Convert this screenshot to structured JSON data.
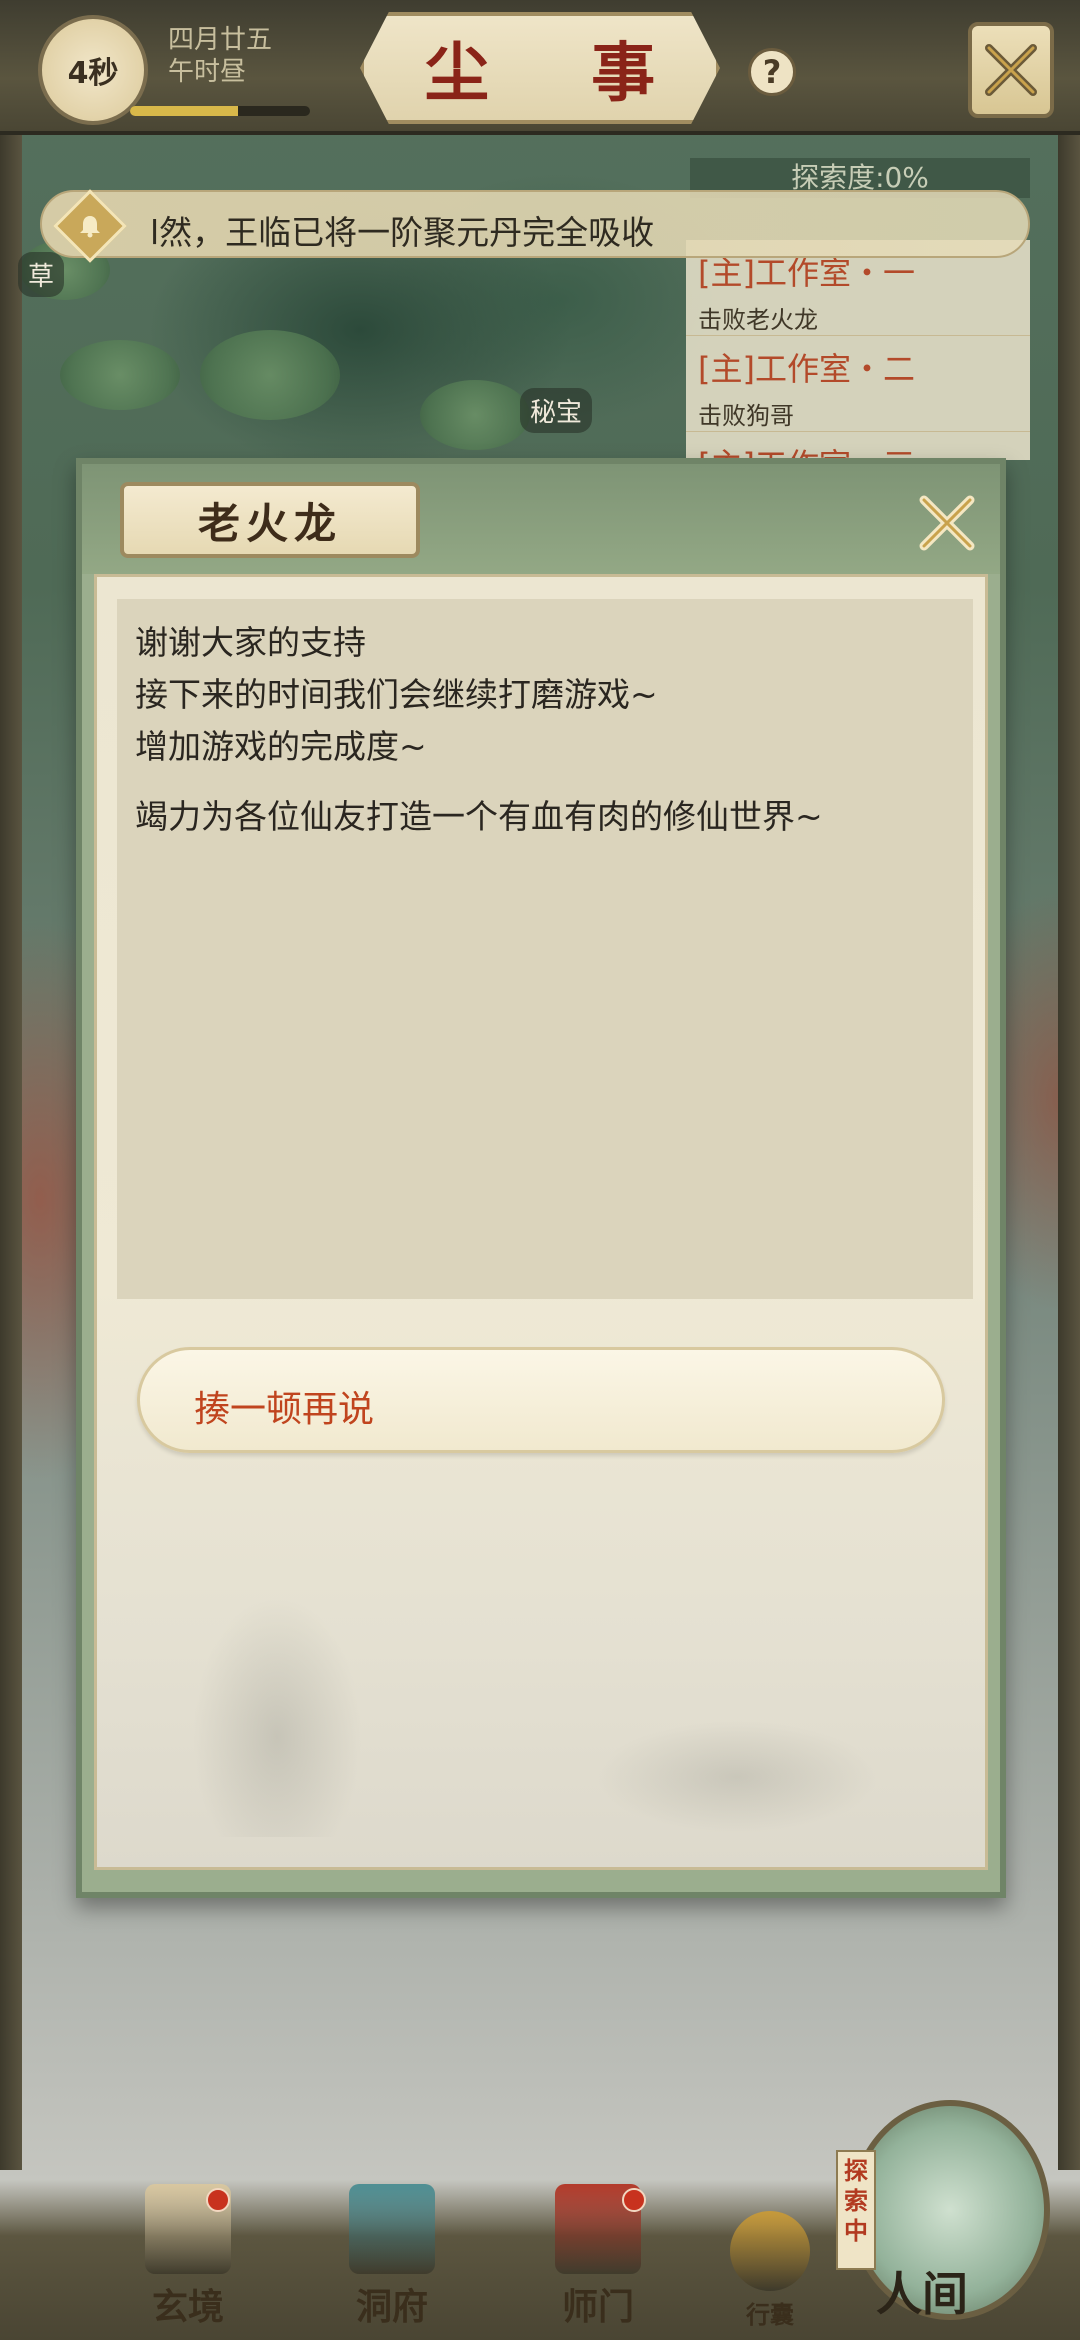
{
  "header": {
    "timer": "4秒",
    "date_line1": "四月廿五",
    "date_line2": "午时昼",
    "title": "尘 事",
    "help_label": "?",
    "time_progress": 0.6
  },
  "notice": {
    "text": "l然，王临已将一阶聚元丹完全吸收"
  },
  "explore": {
    "label": "探索度:0%"
  },
  "quests": [
    {
      "title": "[主]工作室・一",
      "subtitle": "击败老火龙"
    },
    {
      "title": "[主]工作室・二",
      "subtitle": "击败狗哥"
    },
    {
      "title": "[主]工作室・三",
      "subtitle": ""
    }
  ],
  "map_labels": {
    "left": "草",
    "treasure": "秘宝"
  },
  "dialog": {
    "speaker": "老火龙",
    "lines": [
      "谢谢大家的支持",
      "接下来的时间我们会继续打磨游戏~",
      "增加游戏的完成度~",
      "竭力为各位仙友打造一个有血有肉的修仙世界~"
    ],
    "choice": "揍一顿再说"
  },
  "bottom_nav": {
    "items": [
      {
        "label": "玄境",
        "icon": "scroll-icon",
        "color": "#d8c7a0"
      },
      {
        "label": "洞府",
        "icon": "pavilion-icon",
        "color": "#4f8f93"
      },
      {
        "label": "师门",
        "icon": "banner-icon",
        "color": "#b33a2a"
      },
      {
        "label": "行囊",
        "icon": "bag-icon",
        "color": "#c79a3a"
      }
    ],
    "world_label": "人间",
    "world_tag": "探索中"
  },
  "colors": {
    "accent_red": "#c0441e",
    "title_red": "#8a2418",
    "dialog_green": "#7e9475",
    "parchment": "#ece6d1"
  }
}
